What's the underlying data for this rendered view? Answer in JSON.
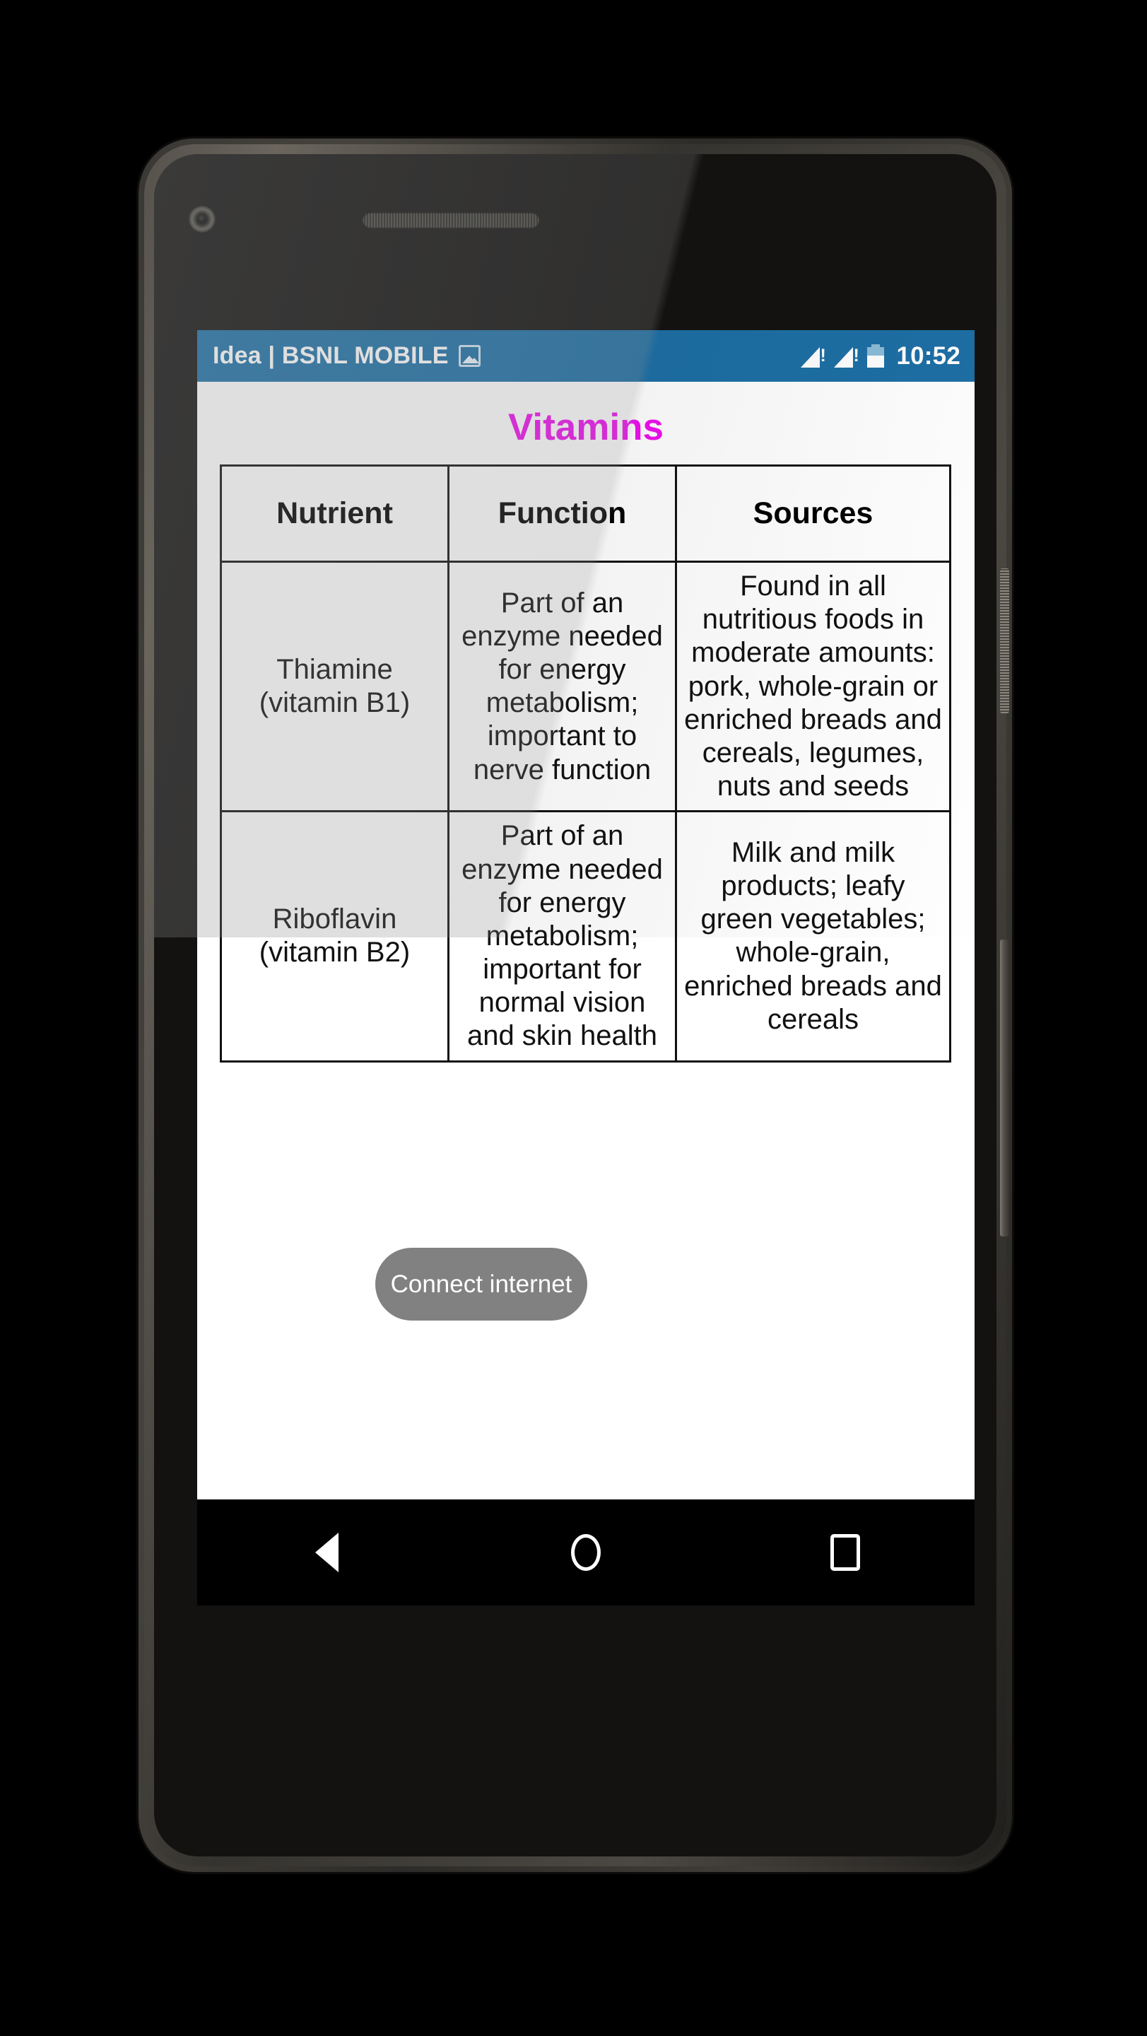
{
  "status_bar": {
    "carrier": "Idea | BSNL MOBILE",
    "image_icon": "image-icon",
    "signal_1": "signal-warning-icon",
    "signal_2": "signal-warning-icon",
    "battery": "battery-icon",
    "clock": "10:52"
  },
  "page": {
    "title": "Vitamins",
    "title_color": "#ef10ef"
  },
  "table": {
    "headers": [
      "Nutrient",
      "Function",
      "Sources"
    ],
    "rows": [
      {
        "nutrient": "Thiamine (vitamin B1)",
        "function": "Part of an enzyme needed for energy metabolism; important to nerve function",
        "sources": "Found in all nutritious foods in moderate amounts: pork, whole-grain or enriched breads and cereals, legumes, nuts and seeds"
      },
      {
        "nutrient": "Riboflavin (vitamin B2)",
        "function": "Part of an enzyme needed for energy metabolism; important for normal vision and skin health",
        "sources": "Milk and milk products; leafy green vegetables; whole-grain, enriched breads and cereals"
      }
    ]
  },
  "toast": {
    "message": "Connect internet"
  },
  "nav_bar": {
    "back": "back-icon",
    "home": "home-icon",
    "recents": "recents-icon"
  },
  "hardware": {
    "camera": "front-camera",
    "earpiece": "earpiece-speaker",
    "sensor": "proximity-sensor",
    "power_button": "power-button",
    "volume_button": "volume-button"
  }
}
